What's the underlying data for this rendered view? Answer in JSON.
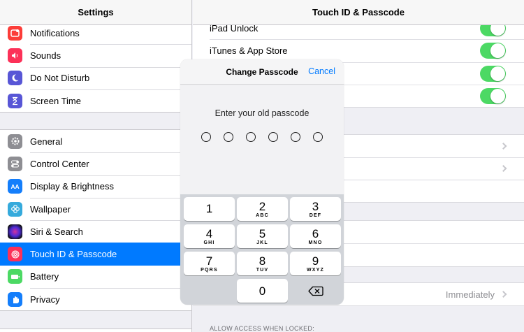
{
  "sidebar": {
    "title": "Settings",
    "group1": [
      {
        "label": "Notifications",
        "icon": "notifications-icon",
        "color": "#fc3d39"
      },
      {
        "label": "Sounds",
        "icon": "sounds-icon",
        "color": "#fc3158"
      },
      {
        "label": "Do Not Disturb",
        "icon": "moon-icon",
        "color": "#5856d6"
      },
      {
        "label": "Screen Time",
        "icon": "hourglass-icon",
        "color": "#5856d6"
      }
    ],
    "group2": [
      {
        "label": "General",
        "icon": "gear-icon",
        "color": "#8e8e93"
      },
      {
        "label": "Control Center",
        "icon": "switches-icon",
        "color": "#8e8e93"
      },
      {
        "label": "Display & Brightness",
        "icon": "display-icon",
        "color": "#147efb",
        "glyph": "AA"
      },
      {
        "label": "Wallpaper",
        "icon": "wallpaper-icon",
        "color": "#35aadc"
      },
      {
        "label": "Siri & Search",
        "icon": "siri-icon",
        "color": "#222222"
      },
      {
        "label": "Touch ID & Passcode",
        "icon": "fingerprint-icon",
        "color": "#fc3158",
        "selected": true
      },
      {
        "label": "Battery",
        "icon": "battery-icon",
        "color": "#4cd964"
      },
      {
        "label": "Privacy",
        "icon": "hand-icon",
        "color": "#147efb"
      }
    ]
  },
  "detail": {
    "title": "Touch ID & Passcode",
    "toggles": [
      "iPad Unlock",
      "iTunes & App Store"
    ],
    "require_value": "Immediately",
    "section_allow": "ALLOW ACCESS WHEN LOCKED:"
  },
  "modal": {
    "title": "Change Passcode",
    "cancel": "Cancel",
    "prompt": "Enter your old passcode",
    "keys": [
      {
        "num": "1",
        "letters": ""
      },
      {
        "num": "2",
        "letters": "ABC"
      },
      {
        "num": "3",
        "letters": "DEF"
      },
      {
        "num": "4",
        "letters": "GHI"
      },
      {
        "num": "5",
        "letters": "JKL"
      },
      {
        "num": "6",
        "letters": "MNO"
      },
      {
        "num": "7",
        "letters": "PQRS"
      },
      {
        "num": "8",
        "letters": "TUV"
      },
      {
        "num": "9",
        "letters": "WXYZ"
      },
      {
        "num": "0",
        "letters": ""
      }
    ],
    "delete_icon": "delete-backspace-icon"
  },
  "colors": {
    "accent": "#007aff",
    "toggle_on": "#4cd964"
  }
}
